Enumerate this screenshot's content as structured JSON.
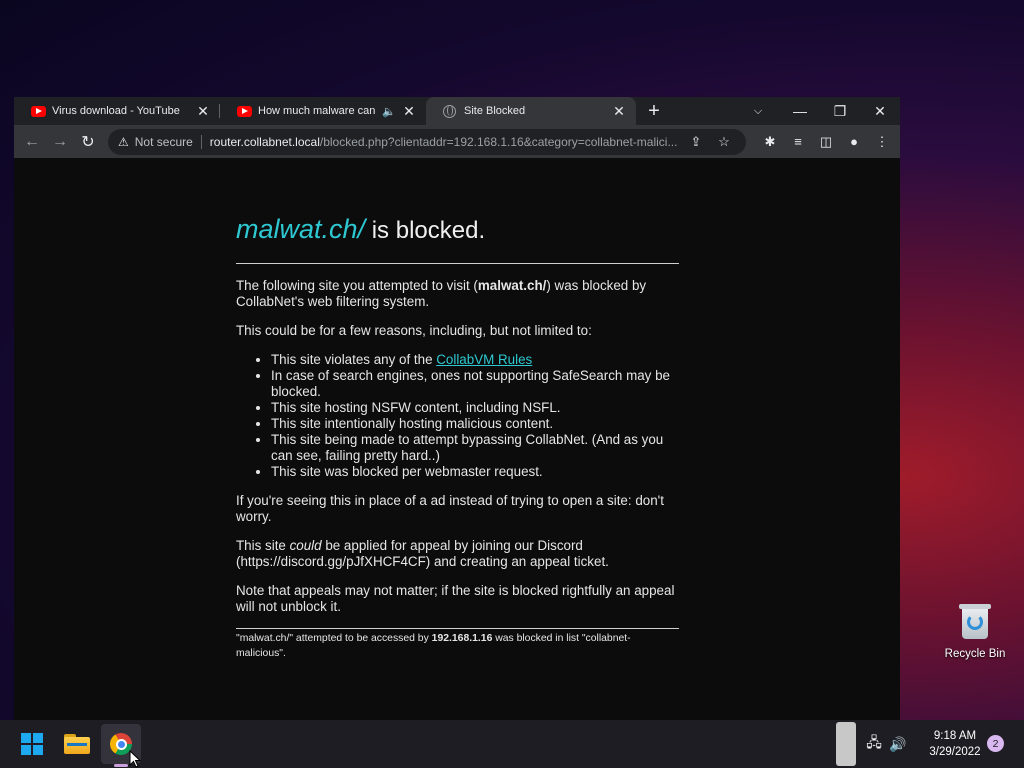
{
  "browser": {
    "tabs": [
      {
        "title": "Virus download - YouTube",
        "icon": "youtube-icon",
        "close": "✕"
      },
      {
        "title": "How much malware can you",
        "icon": "youtube-icon",
        "close": "✕",
        "audio_icon": "🔈"
      },
      {
        "title": "Site Blocked",
        "icon": "globe-icon",
        "close": "✕"
      }
    ],
    "new_tab_label": "+",
    "tab_search_label": "⌵",
    "window_controls": {
      "minimize": "—",
      "restore": "❐",
      "close": "✕"
    },
    "toolbar": {
      "back": "←",
      "forward": "→",
      "reload": "↻",
      "security_icon": "⚠",
      "security_label": "Not secure",
      "url_host": "router.collabnet.local",
      "url_path": "/blocked.php?clientaddr=192.168.1.16&category=collabnet-malici...",
      "share_icon": "⇪",
      "bookmark_icon": "☆",
      "extensions_icon": "✱",
      "media_icon": "≡",
      "sidepanel_icon": "◫",
      "profile_icon": "●",
      "menu_icon": "⋮"
    }
  },
  "page": {
    "heading_site": "malwat.ch/",
    "heading_rest": " is blocked.",
    "intro_pre": "The following site you attempted to visit (",
    "intro_site": "malwat.ch/",
    "intro_post": ") was blocked by CollabNet's web filtering system.",
    "reasons_intro": "This could be for a few reasons, including, but not limited to:",
    "reason_1_pre": "This site violates any of the ",
    "reason_1_link": "CollabVM Rules",
    "reasons": [
      "In case of search engines, ones not supporting SafeSearch may be blocked.",
      "This site hosting NSFW content, including NSFL.",
      "This site intentionally hosting malicious content.",
      "This site being made to attempt bypassing CollabNet. (And as you can see, failing pretty hard..)",
      "This site was blocked per webmaster request."
    ],
    "ad_note": "If you're seeing this in place of a ad instead of trying to open a site: don't worry.",
    "appeal_pre": "This site ",
    "appeal_em": "could",
    "appeal_post": " be applied for appeal by joining our Discord (https://discord.gg/pJfXHCF4CF) and creating an appeal ticket.",
    "appeal_note": "Note that appeals may not matter; if the site is blocked rightfully an appeal will not unblock it.",
    "footer_pre": "\"malwat.ch/\" attempted to be accessed by ",
    "footer_ip": "192.168.1.16",
    "footer_post": " was blocked in list \"collabnet-malicious\"."
  },
  "desktop": {
    "recycle_bin_label": "Recycle Bin"
  },
  "taskbar": {
    "time": "9:18 AM",
    "date": "3/29/2022",
    "notification_count": "2",
    "network_icon": "🖧",
    "volume_icon": "🔊"
  },
  "colors": {
    "accent_link": "#2ec8d2",
    "page_bg": "#0c0c0c",
    "chrome_dark": "#202124"
  }
}
